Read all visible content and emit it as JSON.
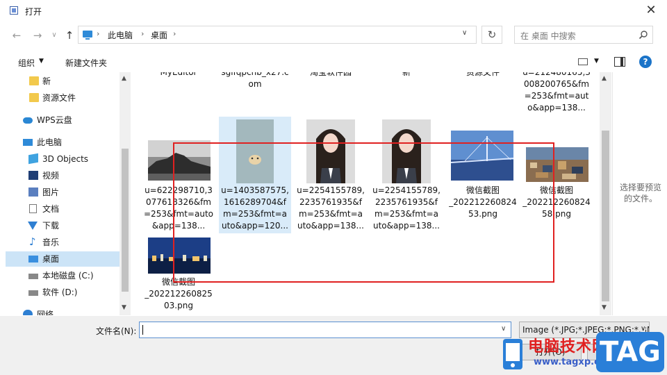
{
  "window": {
    "title": "打开",
    "close_glyph": "✕"
  },
  "nav": {
    "back_glyph": "←",
    "forward_glyph": "→",
    "dropdown_glyph": "∨",
    "up_glyph": "↑",
    "breadcrumb": [
      "此电脑",
      "桌面"
    ],
    "breadcrumb_sep": "›",
    "refresh_glyph": "↻",
    "search_placeholder": "在 桌面 中搜索"
  },
  "toolbar": {
    "organize": "组织",
    "new_folder": "新建文件夹",
    "caret": "▼",
    "help": "?"
  },
  "sidebar": {
    "items": [
      {
        "label": "新",
        "icon": "folder-icon"
      },
      {
        "label": "资源文件",
        "icon": "folder-icon"
      },
      {
        "label": "WPS云盘",
        "icon": "cloud-icon"
      },
      {
        "label": "此电脑",
        "icon": "computer-icon"
      },
      {
        "label": "3D Objects",
        "icon": "cube-icon"
      },
      {
        "label": "视频",
        "icon": "video-icon"
      },
      {
        "label": "图片",
        "icon": "picture-icon"
      },
      {
        "label": "文档",
        "icon": "document-icon"
      },
      {
        "label": "下载",
        "icon": "download-icon"
      },
      {
        "label": "音乐",
        "icon": "music-icon"
      },
      {
        "label": "桌面",
        "icon": "desktop-icon",
        "selected": true
      },
      {
        "label": "本地磁盘 (C:)",
        "icon": "disk-icon"
      },
      {
        "label": "软件 (D:)",
        "icon": "disk-icon"
      },
      {
        "label": "网络",
        "icon": "network-icon"
      }
    ]
  },
  "files": {
    "top_row": [
      {
        "name": "MyEditor"
      },
      {
        "name": "sglfqpchb_x27.c\nom"
      },
      {
        "name": "淘宝软件园"
      },
      {
        "name": "新"
      },
      {
        "name": "资源文件"
      },
      {
        "name": "u=212480165,3\n008200765&fm\n=253&fmt=aut\no&app=138..."
      }
    ],
    "row2": [
      {
        "name": "u=622298710,3\n077618326&fm\n=253&fmt=auto\n&app=138...",
        "thumb": "rock-photo"
      },
      {
        "name": "u=1403587575,\n1616289704&f\nm=253&fmt=a\nuto&app=120...",
        "thumb": "dog-sticker",
        "selected": true
      },
      {
        "name": "u=2254155789,\n2235761935&f\nm=253&fmt=a\nuto&app=138...",
        "thumb": "portrait-photo"
      },
      {
        "name": "u=2254155789,\n2235761935&f\nm=253&fmt=a\nuto&app=138...",
        "thumb": "portrait-photo"
      },
      {
        "name": "微信截图\n_202212260824\n53.png",
        "thumb": "bridge-photo"
      },
      {
        "name": "微信截图\n_202212260824\n58.png",
        "thumb": "city-photo"
      }
    ],
    "row3": [
      {
        "name": "微信截图\n_202212260825\n03.png",
        "thumb": "skyline-photo"
      }
    ]
  },
  "preview": {
    "text": "选择要预览\n的文件。"
  },
  "bottom": {
    "filename_label": "文件名(N):",
    "filename_value": "",
    "filetype": "Image (*.JPG;*.JPEG;*.PNG;*.BMP)",
    "open": "打开(O)",
    "cancel": "取消"
  },
  "watermark": {
    "main": "电脑技术网",
    "url": "www.tagxp.com",
    "tag": "TAG"
  }
}
